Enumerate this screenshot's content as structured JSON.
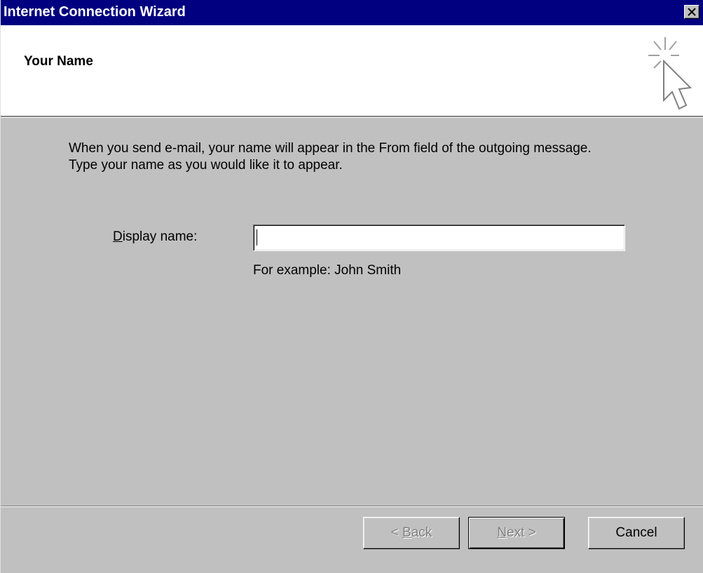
{
  "window": {
    "title": "Internet Connection Wizard",
    "close_icon": "close-x-icon"
  },
  "header": {
    "title": "Your Name",
    "icon": "wizard-sparkle-cursor-icon"
  },
  "body": {
    "instruction_line1": "When you send e-mail, your name will appear in the From field of the outgoing message.",
    "instruction_line2": "Type your name as you would like it to appear.",
    "display_name_label_first": "D",
    "display_name_label_rest": "isplay name:",
    "display_name_value": "",
    "example_text": "For example: John Smith"
  },
  "buttons": {
    "back_prefix": "< ",
    "back_accel": "B",
    "back_rest": "ack",
    "next_accel": "N",
    "next_rest": "ext >",
    "cancel": "Cancel"
  },
  "colors": {
    "titlebar": "#000080",
    "face": "#c0c0c0",
    "header_bg": "#ffffff"
  }
}
